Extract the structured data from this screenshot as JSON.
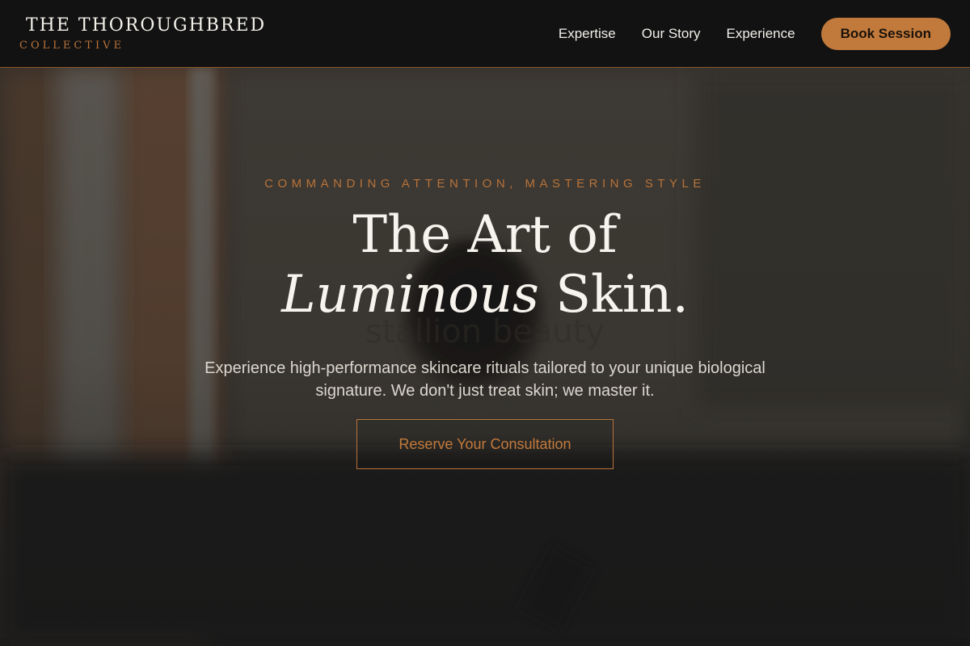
{
  "header": {
    "brand_name": "THE THOROUGHBRED",
    "brand_sub": "COLLECTIVE",
    "nav": [
      {
        "label": "Expertise"
      },
      {
        "label": "Our Story"
      },
      {
        "label": "Experience"
      }
    ],
    "book_label": "Book Session"
  },
  "hero": {
    "eyebrow": "COMMANDING ATTENTION, MASTERING STYLE",
    "headline_line1": "The Art of",
    "headline_italic": "Luminous",
    "headline_rest": " Skin.",
    "subtext": "Experience high-performance skincare rituals tailored to your unique biological signature. We don't just treat skin; we master it.",
    "cta_label": "Reserve Your Consultation"
  },
  "colors": {
    "accent": "#c27a3c",
    "header_bg": "#121212",
    "text_light": "#f7f4ee"
  }
}
